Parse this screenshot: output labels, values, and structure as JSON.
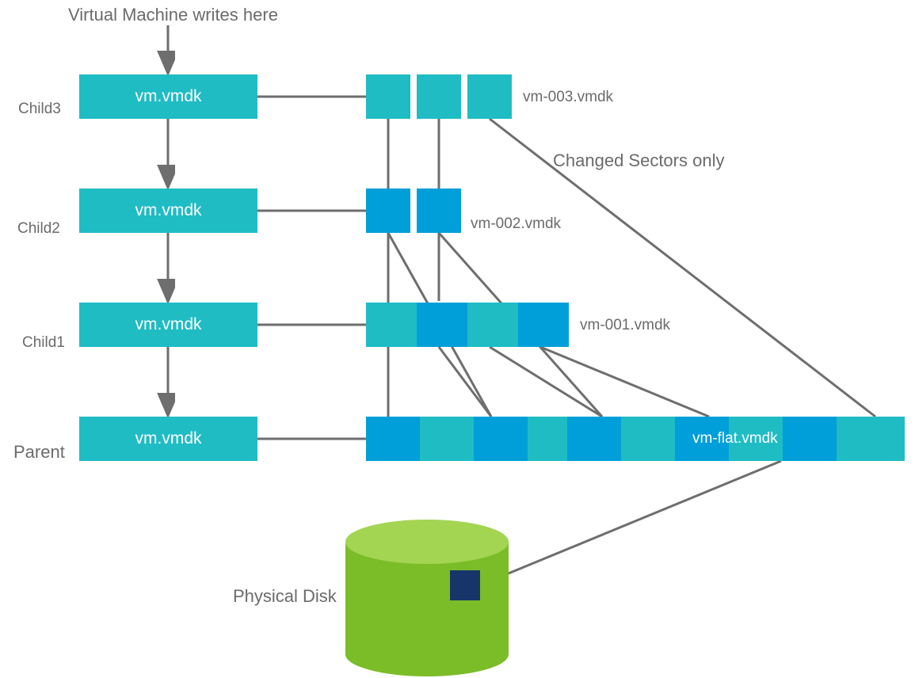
{
  "labels": {
    "title": "Virtual Machine writes here",
    "changed": "Changed Sectors only",
    "physical": "Physical Disk",
    "flatlabel": "vm-flat.vmdk"
  },
  "rows": [
    {
      "name": "Child3",
      "box": "vm.vmdk",
      "file": "vm-003.vmdk"
    },
    {
      "name": "Child2",
      "box": "vm.vmdk",
      "file": "vm-002.vmdk"
    },
    {
      "name": "Child1",
      "box": "vm.vmdk",
      "file": "vm-001.vmdk"
    },
    {
      "name": "Parent",
      "box": "vm.vmdk",
      "file": ""
    }
  ],
  "colors": {
    "teal": "#1fbcc4",
    "blue": "#009fd9",
    "green": "#7bbd28",
    "lightgreen": "#a3d553",
    "navy": "#18356a",
    "line": "#6e6e6e",
    "text": "#6b6b6b"
  },
  "diagram_data": {
    "type": "hierarchy",
    "description": "VMware snapshot chain: parent disk with three child delta disks, each storing only changed sectors, backed by a physical disk.",
    "nodes": [
      {
        "id": "child3",
        "label": "vm.vmdk",
        "file": "vm-003.vmdk",
        "sectors": 3
      },
      {
        "id": "child2",
        "label": "vm.vmdk",
        "file": "vm-002.vmdk",
        "sectors": 2
      },
      {
        "id": "child1",
        "label": "vm.vmdk",
        "file": "vm-001.vmdk",
        "sectors": 4
      },
      {
        "id": "parent",
        "label": "vm.vmdk",
        "file": "vm-flat.vmdk",
        "sectors": 10
      },
      {
        "id": "disk",
        "label": "Physical Disk"
      }
    ],
    "edges": [
      [
        "write",
        "child3"
      ],
      [
        "child3",
        "child2"
      ],
      [
        "child2",
        "child1"
      ],
      [
        "child1",
        "parent"
      ],
      [
        "parent",
        "disk"
      ]
    ]
  }
}
